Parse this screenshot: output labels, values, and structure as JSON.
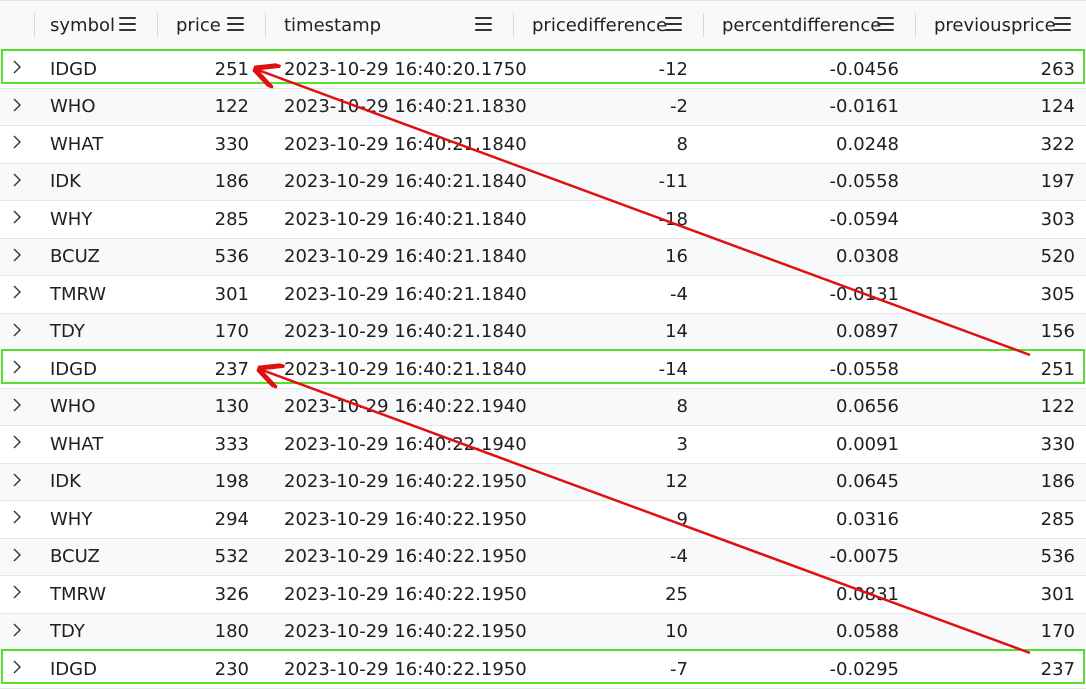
{
  "columns": {
    "symbol": "symbol",
    "price": "price",
    "timestamp": "timestamp",
    "pricedifference": "pricedifference",
    "percentdifference": "percentdifference",
    "previousprice": "previousprice"
  },
  "rows": [
    {
      "symbol": "IDGD",
      "price": "251",
      "timestamp": "2023-10-29 16:40:20.1750",
      "pricedifference": "-12",
      "percentdifference": "-0.0456",
      "previousprice": "263"
    },
    {
      "symbol": "WHO",
      "price": "122",
      "timestamp": "2023-10-29 16:40:21.1830",
      "pricedifference": "-2",
      "percentdifference": "-0.0161",
      "previousprice": "124"
    },
    {
      "symbol": "WHAT",
      "price": "330",
      "timestamp": "2023-10-29 16:40:21.1840",
      "pricedifference": "8",
      "percentdifference": "0.0248",
      "previousprice": "322"
    },
    {
      "symbol": "IDK",
      "price": "186",
      "timestamp": "2023-10-29 16:40:21.1840",
      "pricedifference": "-11",
      "percentdifference": "-0.0558",
      "previousprice": "197"
    },
    {
      "symbol": "WHY",
      "price": "285",
      "timestamp": "2023-10-29 16:40:21.1840",
      "pricedifference": "-18",
      "percentdifference": "-0.0594",
      "previousprice": "303"
    },
    {
      "symbol": "BCUZ",
      "price": "536",
      "timestamp": "2023-10-29 16:40:21.1840",
      "pricedifference": "16",
      "percentdifference": "0.0308",
      "previousprice": "520"
    },
    {
      "symbol": "TMRW",
      "price": "301",
      "timestamp": "2023-10-29 16:40:21.1840",
      "pricedifference": "-4",
      "percentdifference": "-0.0131",
      "previousprice": "305"
    },
    {
      "symbol": "TDY",
      "price": "170",
      "timestamp": "2023-10-29 16:40:21.1840",
      "pricedifference": "14",
      "percentdifference": "0.0897",
      "previousprice": "156"
    },
    {
      "symbol": "IDGD",
      "price": "237",
      "timestamp": "2023-10-29 16:40:21.1840",
      "pricedifference": "-14",
      "percentdifference": "-0.0558",
      "previousprice": "251"
    },
    {
      "symbol": "WHO",
      "price": "130",
      "timestamp": "2023-10-29 16:40:22.1940",
      "pricedifference": "8",
      "percentdifference": "0.0656",
      "previousprice": "122"
    },
    {
      "symbol": "WHAT",
      "price": "333",
      "timestamp": "2023-10-29 16:40:22.1940",
      "pricedifference": "3",
      "percentdifference": "0.0091",
      "previousprice": "330"
    },
    {
      "symbol": "IDK",
      "price": "198",
      "timestamp": "2023-10-29 16:40:22.1950",
      "pricedifference": "12",
      "percentdifference": "0.0645",
      "previousprice": "186"
    },
    {
      "symbol": "WHY",
      "price": "294",
      "timestamp": "2023-10-29 16:40:22.1950",
      "pricedifference": "9",
      "percentdifference": "0.0316",
      "previousprice": "285"
    },
    {
      "symbol": "BCUZ",
      "price": "532",
      "timestamp": "2023-10-29 16:40:22.1950",
      "pricedifference": "-4",
      "percentdifference": "-0.0075",
      "previousprice": "536"
    },
    {
      "symbol": "TMRW",
      "price": "326",
      "timestamp": "2023-10-29 16:40:22.1950",
      "pricedifference": "25",
      "percentdifference": "0.0831",
      "previousprice": "301"
    },
    {
      "symbol": "TDY",
      "price": "180",
      "timestamp": "2023-10-29 16:40:22.1950",
      "pricedifference": "10",
      "percentdifference": "0.0588",
      "previousprice": "170"
    },
    {
      "symbol": "IDGD",
      "price": "230",
      "timestamp": "2023-10-29 16:40:22.1950",
      "pricedifference": "-7",
      "percentdifference": "-0.0295",
      "previousprice": "237"
    }
  ],
  "annotations": {
    "highlight_color": "#55e02a",
    "arrow_color": "#e01010",
    "highlighted_row_indices": [
      0,
      8,
      16
    ]
  },
  "icons": {
    "expand": "chevron-right-icon",
    "column_menu": "hamburger-menu-icon"
  }
}
